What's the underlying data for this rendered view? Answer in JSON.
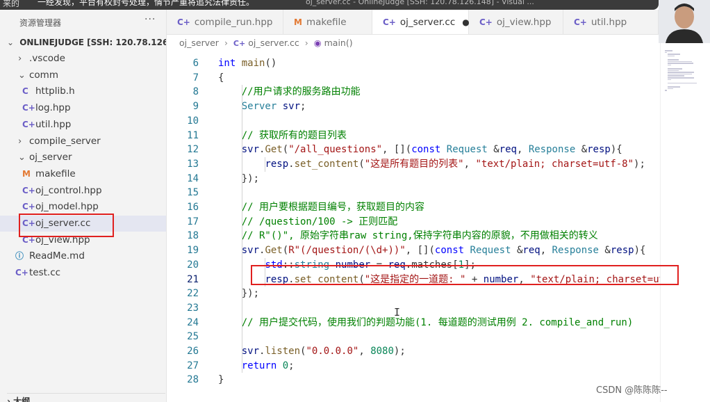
{
  "overlay": {
    "left_text": "来的",
    "notice": "一经发现，平台有权封号处理，情节严重将追究法律责任。",
    "window_title": "oj_server.cc - OnlineJudge [SSH: 120.78.126.148] - Visual ..."
  },
  "sidebar": {
    "header": "资源管理器",
    "more": "···",
    "root": "ONLINEJUDGE [SSH: 120.78.126.148]",
    "items": [
      {
        "label": ".vscode",
        "kind": "folder",
        "open": false,
        "depth": 1
      },
      {
        "label": "comm",
        "kind": "folder",
        "open": true,
        "depth": 1
      },
      {
        "label": "httplib.h",
        "kind": "c",
        "depth": 2
      },
      {
        "label": "log.hpp",
        "kind": "cpp",
        "depth": 2
      },
      {
        "label": "util.hpp",
        "kind": "cpp",
        "depth": 2
      },
      {
        "label": "compile_server",
        "kind": "folder",
        "open": false,
        "depth": 1
      },
      {
        "label": "oj_server",
        "kind": "folder",
        "open": true,
        "depth": 1
      },
      {
        "label": "makefile",
        "kind": "makefile",
        "depth": 2
      },
      {
        "label": "oj_control.hpp",
        "kind": "cpp",
        "depth": 2
      },
      {
        "label": "oj_model.hpp",
        "kind": "cpp",
        "depth": 2
      },
      {
        "label": "oj_server.cc",
        "kind": "cpp",
        "depth": 2,
        "selected": true
      },
      {
        "label": "oj_view.hpp",
        "kind": "cpp",
        "depth": 2
      },
      {
        "label": "ReadMe.md",
        "kind": "info",
        "depth": 1
      },
      {
        "label": "test.cc",
        "kind": "cpp",
        "depth": 1
      }
    ],
    "outline": "大纲"
  },
  "tabs": [
    {
      "label": "compile_run.hpp",
      "icon": "C",
      "active": false
    },
    {
      "label": "makefile",
      "icon": "M",
      "active": false
    },
    {
      "label": "oj_server.cc",
      "icon": "C",
      "active": true,
      "dirty": true
    },
    {
      "label": "oj_view.hpp",
      "icon": "C",
      "active": false
    },
    {
      "label": "util.hpp",
      "icon": "C",
      "active": false
    }
  ],
  "breadcrumb": [
    "oj_server",
    "oj_server.cc",
    "main()"
  ],
  "editor": {
    "current_line": 21,
    "lines": [
      {
        "n": "6",
        "t": "int main()"
      },
      {
        "n": "7",
        "t": "{"
      },
      {
        "n": "8",
        "t": "    //用户请求的服务路由功能"
      },
      {
        "n": "9",
        "t": "    Server svr;"
      },
      {
        "n": "10",
        "t": ""
      },
      {
        "n": "11",
        "t": "    // 获取所有的题目列表"
      },
      {
        "n": "12",
        "t": "    svr.Get(\"/all_questions\", [](const Request &req, Response &resp){"
      },
      {
        "n": "13",
        "t": "        resp.set_content(\"这是所有题目的列表\", \"text/plain; charset=utf-8\");"
      },
      {
        "n": "14",
        "t": "    });"
      },
      {
        "n": "15",
        "t": ""
      },
      {
        "n": "16",
        "t": "    // 用户要根据题目编号，获取题目的内容"
      },
      {
        "n": "17",
        "t": "    // /question/100 -> 正则匹配"
      },
      {
        "n": "18",
        "t": "    // R\"()\", 原始字符串raw string,保持字符串内容的原貌，不用做相关的转义"
      },
      {
        "n": "19",
        "t": "    svr.Get(R\"(/question/(\\d+))\", [](const Request &req, Response &resp){"
      },
      {
        "n": "20",
        "t": "        std::string number = req.matches[1];"
      },
      {
        "n": "21",
        "t": "        resp.set_content(\"这是指定的一道题: \" + number, \"text/plain; charset=ut"
      },
      {
        "n": "22",
        "t": "    });"
      },
      {
        "n": "23",
        "t": ""
      },
      {
        "n": "24",
        "t": "    // 用户提交代码，使用我们的判题功能(1. 每道题的测试用例 2. compile_and_run)"
      },
      {
        "n": "25",
        "t": ""
      },
      {
        "n": "26",
        "t": "    svr.listen(\"0.0.0.0\", 8080);"
      },
      {
        "n": "27",
        "t": "    return 0;"
      },
      {
        "n": "28",
        "t": "}"
      }
    ]
  },
  "watermark": "CSDN @陈陈陈--",
  "colors": {
    "keyword": "#0000ff",
    "string": "#a31515",
    "comment": "#008000",
    "type": "#267f99",
    "function": "#795e26",
    "number": "#098658",
    "highlight_box": "#e0201f"
  }
}
